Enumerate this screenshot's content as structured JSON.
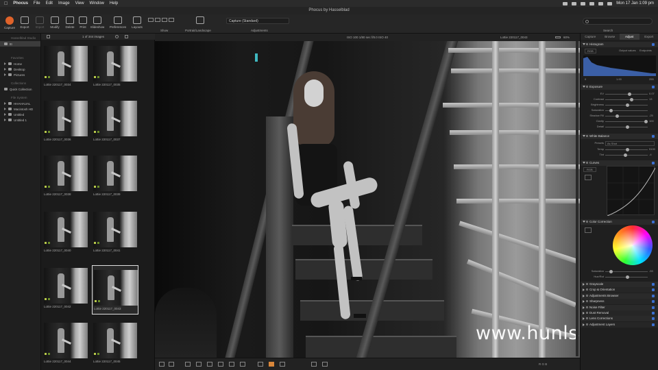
{
  "menubar": {
    "apple": "",
    "app": "Phocus",
    "menus": [
      "File",
      "Edit",
      "Image",
      "View",
      "Window",
      "Help"
    ],
    "clock": "Mon 17 Jan  1:09 pm"
  },
  "window": {
    "title": "Phocus by Hasselblad"
  },
  "toolbar": {
    "buttons": [
      "Capture",
      "Export",
      "Import",
      "Modify",
      "Delete",
      "Print",
      "Slideshow",
      "Preferences",
      "Layouts"
    ],
    "show_label": "Show",
    "portrait_label": "Portrait/Landscape",
    "adjustments_label": "Adjustments",
    "search_label": "Search",
    "preset": "Capture (Standard)"
  },
  "sidebar": {
    "head_top": "Hasselblad Studio",
    "items_top": [
      "ttt"
    ],
    "head_fav": "Favorites",
    "favorites": [
      "Home",
      "Desktop",
      "Pictures"
    ],
    "head_coll": "Collections",
    "collections": [
      "Quick Collection"
    ],
    "head_files": "File System",
    "files": [
      "HHAHAUAL",
      "Macintosh HD",
      "Untitled",
      "Untitled 1"
    ]
  },
  "browser": {
    "count": "1 of 344 images",
    "thumbs": [
      "Lottie 220117_0034",
      "Lottie 220117_0035",
      "Lottie 220117_0036",
      "Lottie 220117_0037",
      "Lottie 220117_0038",
      "Lottie 220117_0039",
      "Lottie 220117_0040",
      "Lottie 220117_0041",
      "Lottie 220117_0042",
      "Lottie 220117_0043",
      "Lottie 220117_0044",
      "Lottie 220117_0045"
    ]
  },
  "viewer": {
    "info": "ISO 100  1/80 sec  f/8.0  ISO 40",
    "filename": "Lottie 220117_0043",
    "zoom": "60%",
    "zoom_fraction": 0.6,
    "watermark": "www.hunls.com",
    "bottom_readout": "R   G   B"
  },
  "panel": {
    "tabs": [
      "Capture",
      "Browse",
      "Adjust",
      "Export"
    ],
    "active_tab": "Adjust",
    "histogram": {
      "title": "Histogram",
      "mode": "RGB",
      "output_values": "Output values",
      "endpoints": "Endpoints",
      "left": "0",
      "mid": "1.00",
      "right": "255"
    },
    "exposure": {
      "title": "Exposure",
      "rows": [
        {
          "label": "EV",
          "value": "0.07",
          "pos": 0.55
        },
        {
          "label": "Contrast",
          "value": "13",
          "pos": 0.6
        },
        {
          "label": "Brightness",
          "value": "",
          "pos": 0.5
        },
        {
          "label": "Saturation",
          "value": "",
          "pos": 0.1
        },
        {
          "label": "Shadow Fill",
          "value": "-25",
          "pos": 0.25
        },
        {
          "label": "Clarity",
          "value": "100",
          "pos": 0.95
        },
        {
          "label": "Detail",
          "value": "",
          "pos": 0.5
        }
      ]
    },
    "white_balance": {
      "title": "White Balance",
      "preset_label": "Presets",
      "preset": "As Shot",
      "rows": [
        {
          "label": "Temp",
          "value": "5100",
          "pos": 0.5
        },
        {
          "label": "Tint",
          "value": "-4",
          "pos": 0.45
        }
      ]
    },
    "curves": {
      "title": "Curves",
      "mode": "RGB"
    },
    "color_correction": {
      "title": "Color Correction",
      "rows": [
        {
          "label": "Saturation",
          "value": "-53",
          "pos": 0.1
        },
        {
          "label": "Hue/Rot",
          "value": "",
          "pos": 0.5
        }
      ]
    },
    "sections": [
      "Grayscale",
      "Crop & Orientation",
      "Adjustments Browser",
      "Sharpness",
      "Noise Filter",
      "Dust Removal",
      "Lens Corrections",
      "Adjustment Layers"
    ]
  }
}
